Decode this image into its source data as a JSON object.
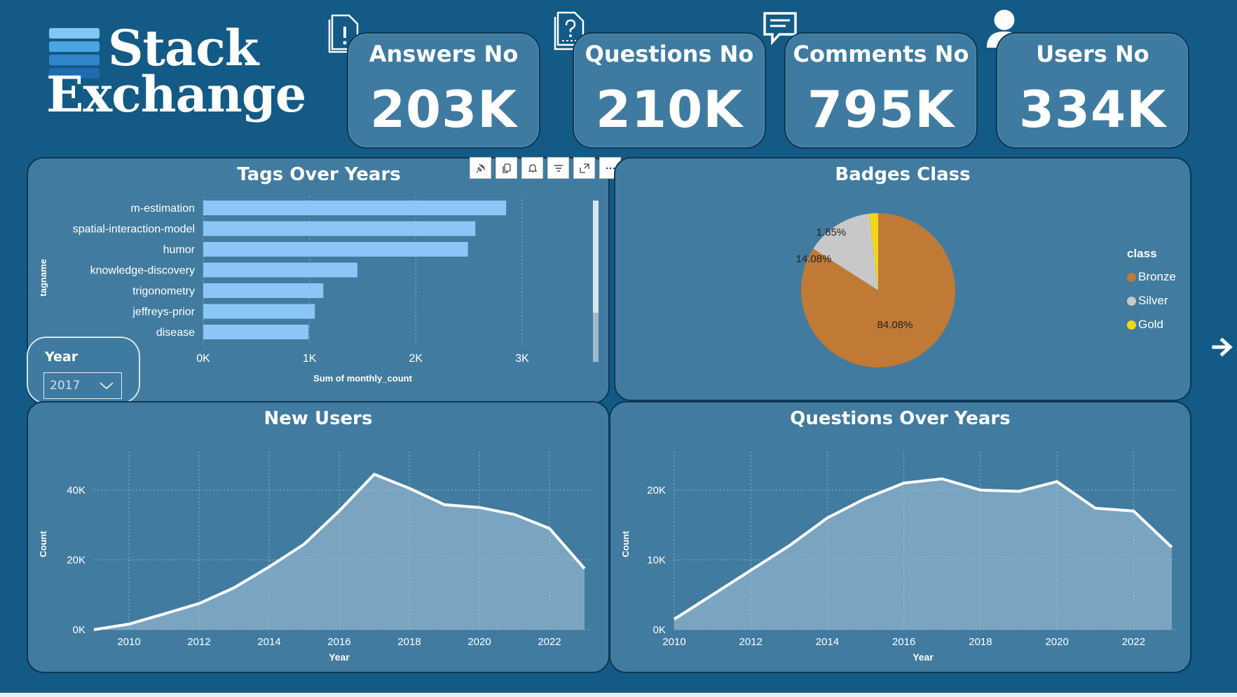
{
  "brand": {
    "line1": "Stack",
    "line2": "Exchange",
    "stack_colors": [
      "#7ec8f2",
      "#4aa6e2",
      "#2f86cc",
      "#1e6bb0"
    ]
  },
  "kpis": [
    {
      "title": "Answers No",
      "value": "203K",
      "icon": "answer-document-icon"
    },
    {
      "title": "Questions No",
      "value": "210K",
      "icon": "question-document-icon"
    },
    {
      "title": "Comments No",
      "value": "795K",
      "icon": "comment-bubble-icon"
    },
    {
      "title": "Users No",
      "value": "334K",
      "icon": "user-person-icon"
    }
  ],
  "toolbar": {
    "icons": [
      "pin-icon",
      "copy-icon",
      "bell-icon",
      "filter-icon",
      "focus-mode-icon",
      "more-options-icon"
    ]
  },
  "slicer": {
    "label": "Year",
    "value": "2017",
    "icon": "chevron-down-icon"
  },
  "colors": {
    "background": "#135a86",
    "panel": "#417b9f",
    "bar": "#8cc6f7",
    "bronze": "#c07a36",
    "silver": "#c8c8c8",
    "gold": "#f0d818"
  },
  "chart_data": [
    {
      "type": "bar",
      "orientation": "horizontal",
      "title": "Tags Over Years",
      "categories": [
        "m-estimation",
        "spatial-interaction-model",
        "humor",
        "knowledge-discovery",
        "trigonometry",
        "jeffreys-prior",
        "disease"
      ],
      "values": [
        2850,
        2560,
        2490,
        1450,
        1130,
        1050,
        990
      ],
      "xlabel": "Sum of monthly_count",
      "ylabel": "tagname",
      "xticks": [
        "0K",
        "1K",
        "2K",
        "3K"
      ],
      "xlim": [
        0,
        3000
      ],
      "grid": true
    },
    {
      "type": "pie",
      "title": "Badges Class",
      "legend_title": "class",
      "legend_position": "right",
      "slices": [
        {
          "label": "Bronze",
          "value": 84.08,
          "display": "84.08%",
          "color": "#c07a36"
        },
        {
          "label": "Silver",
          "value": 14.08,
          "display": "14.08%",
          "color": "#c8c8c8"
        },
        {
          "label": "Gold",
          "value": 1.85,
          "display": "1.85%",
          "color": "#f0d818"
        }
      ]
    },
    {
      "type": "area",
      "title": "New Users",
      "xlabel": "Year",
      "ylabel": "Count",
      "x": [
        2009,
        2010,
        2011,
        2012,
        2013,
        2014,
        2015,
        2016,
        2017,
        2018,
        2019,
        2020,
        2021,
        2022,
        2023
      ],
      "y": [
        0,
        1600,
        4500,
        7500,
        12000,
        18000,
        24500,
        34000,
        44500,
        40500,
        35800,
        35000,
        33000,
        29000,
        17500
      ],
      "xticks": [
        "2010",
        "2012",
        "2014",
        "2016",
        "2018",
        "2020",
        "2022"
      ],
      "yticks": [
        "0K",
        "20K",
        "40K"
      ],
      "xlim": [
        2009,
        2023
      ],
      "ylim": [
        0,
        49000
      ],
      "grid": true
    },
    {
      "type": "area",
      "title": "Questions Over Years",
      "xlabel": "Year",
      "ylabel": "Count",
      "x": [
        2010,
        2011,
        2012,
        2013,
        2014,
        2015,
        2016,
        2017,
        2018,
        2019,
        2020,
        2021,
        2022,
        2023
      ],
      "y": [
        1500,
        5000,
        8500,
        12000,
        16000,
        18800,
        21000,
        21600,
        20000,
        19800,
        21200,
        17400,
        17000,
        11800
      ],
      "xticks": [
        "2010",
        "2012",
        "2014",
        "2016",
        "2018",
        "2020",
        "2022"
      ],
      "yticks": [
        "0K",
        "10K",
        "20K"
      ],
      "xlim": [
        2010,
        2023
      ],
      "ylim": [
        0,
        24500
      ],
      "grid": true
    }
  ],
  "nav": {
    "next_icon": "arrow-right-icon"
  }
}
